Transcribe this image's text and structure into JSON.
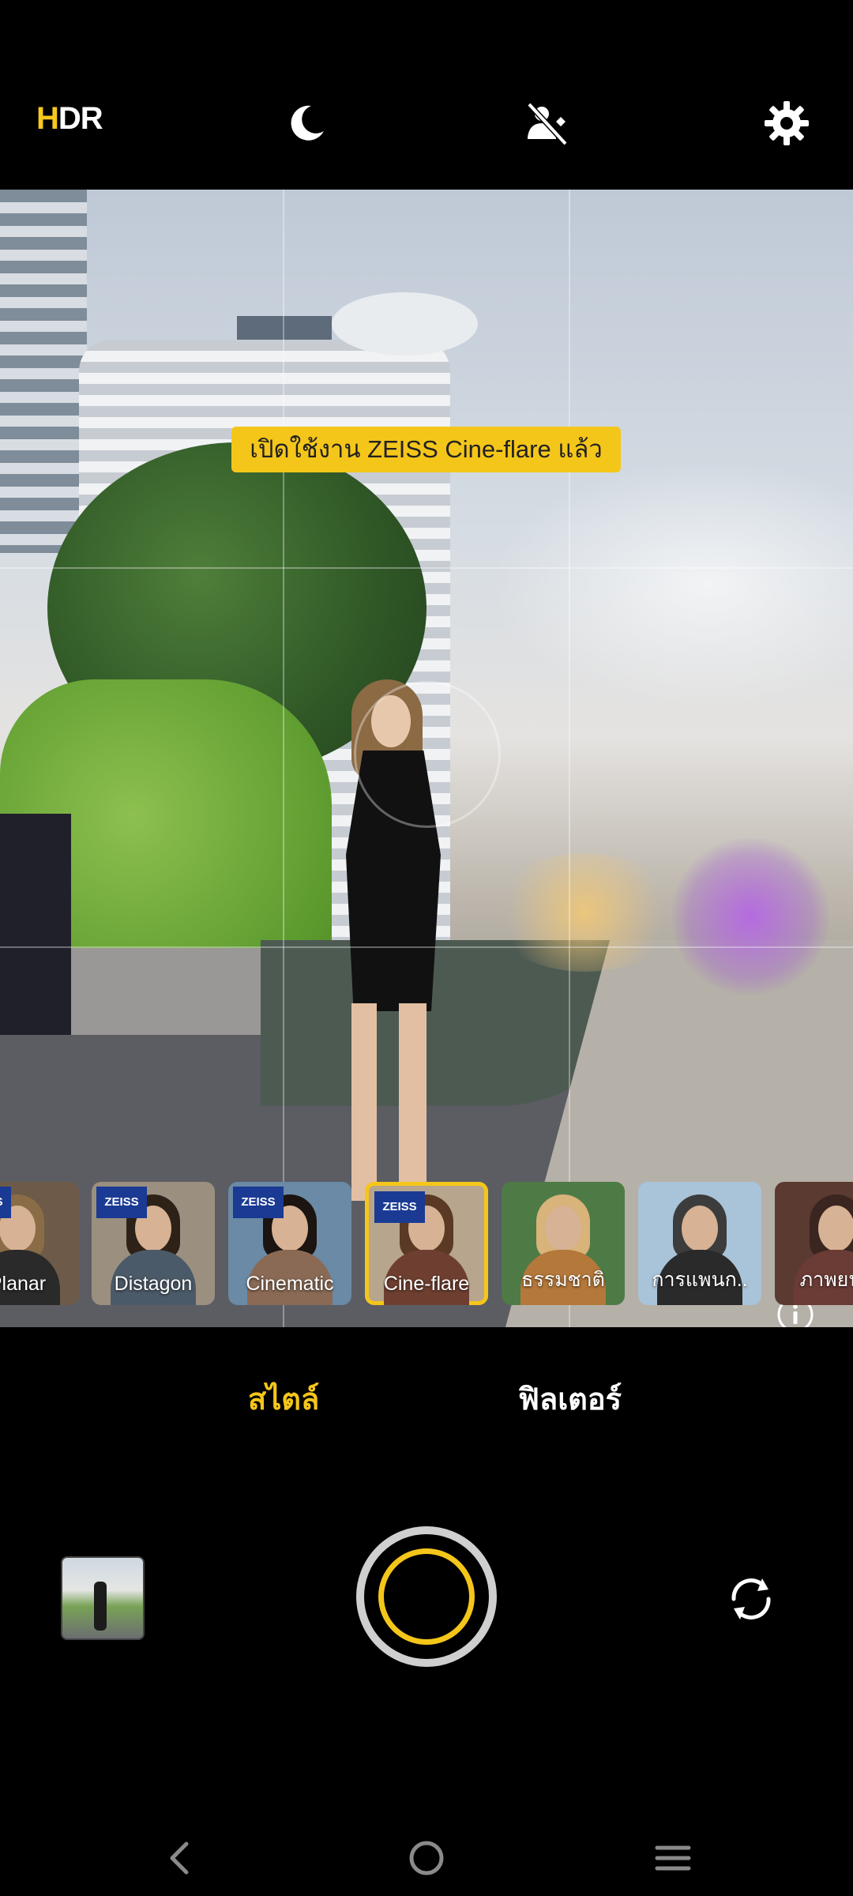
{
  "top_bar": {
    "hdr_h": "H",
    "hdr_dr": "DR",
    "icons": [
      "night-mode-icon",
      "ai-off-icon",
      "settings-icon"
    ]
  },
  "viewfinder": {
    "toast_text": "เปิดใช้งาน ZEISS Cine-flare แล้ว",
    "info_icon": "info-icon"
  },
  "filters": [
    {
      "label": "Planar",
      "badge": "ZEISS",
      "hair": "#8a6c46",
      "body": "#2a2a2a",
      "bg": "#6d5a48"
    },
    {
      "label": "Distagon",
      "badge": "ZEISS",
      "hair": "#2e2218",
      "body": "#4b5a68",
      "bg": "#9b8f80"
    },
    {
      "label": "Cinematic",
      "badge": "ZEISS",
      "hair": "#1b1410",
      "body": "#8a6a55",
      "bg": "#6a8aa5"
    },
    {
      "label": "Cine-flare",
      "badge": "ZEISS",
      "hair": "#5a3a24",
      "body": "#6e3f30",
      "bg": "#b7a58e",
      "selected": true
    },
    {
      "label": "ธรรมชาติ",
      "badge": "",
      "hair": "#d8b37a",
      "body": "#b4783a",
      "bg": "#4e7a46"
    },
    {
      "label": "การแพนก..",
      "badge": "",
      "hair": "#3c3c3c",
      "body": "#2a2a2a",
      "bg": "#a9c3d9"
    },
    {
      "label": "ภาพยน..",
      "badge": "",
      "hair": "#3a2520",
      "body": "#6b3b35",
      "bg": "#5b3a32"
    }
  ],
  "mode_tabs": {
    "style": "สไตล์",
    "filter": "ฟิลเตอร์",
    "active": "style"
  },
  "controls": {
    "gallery": "gallery-thumbnail",
    "shutter": "shutter-button",
    "flip": "switch-camera-icon"
  },
  "navbar": [
    "back-icon",
    "home-icon",
    "menu-icon"
  ],
  "colors": {
    "accent": "#f5c61a",
    "background": "#000000"
  }
}
